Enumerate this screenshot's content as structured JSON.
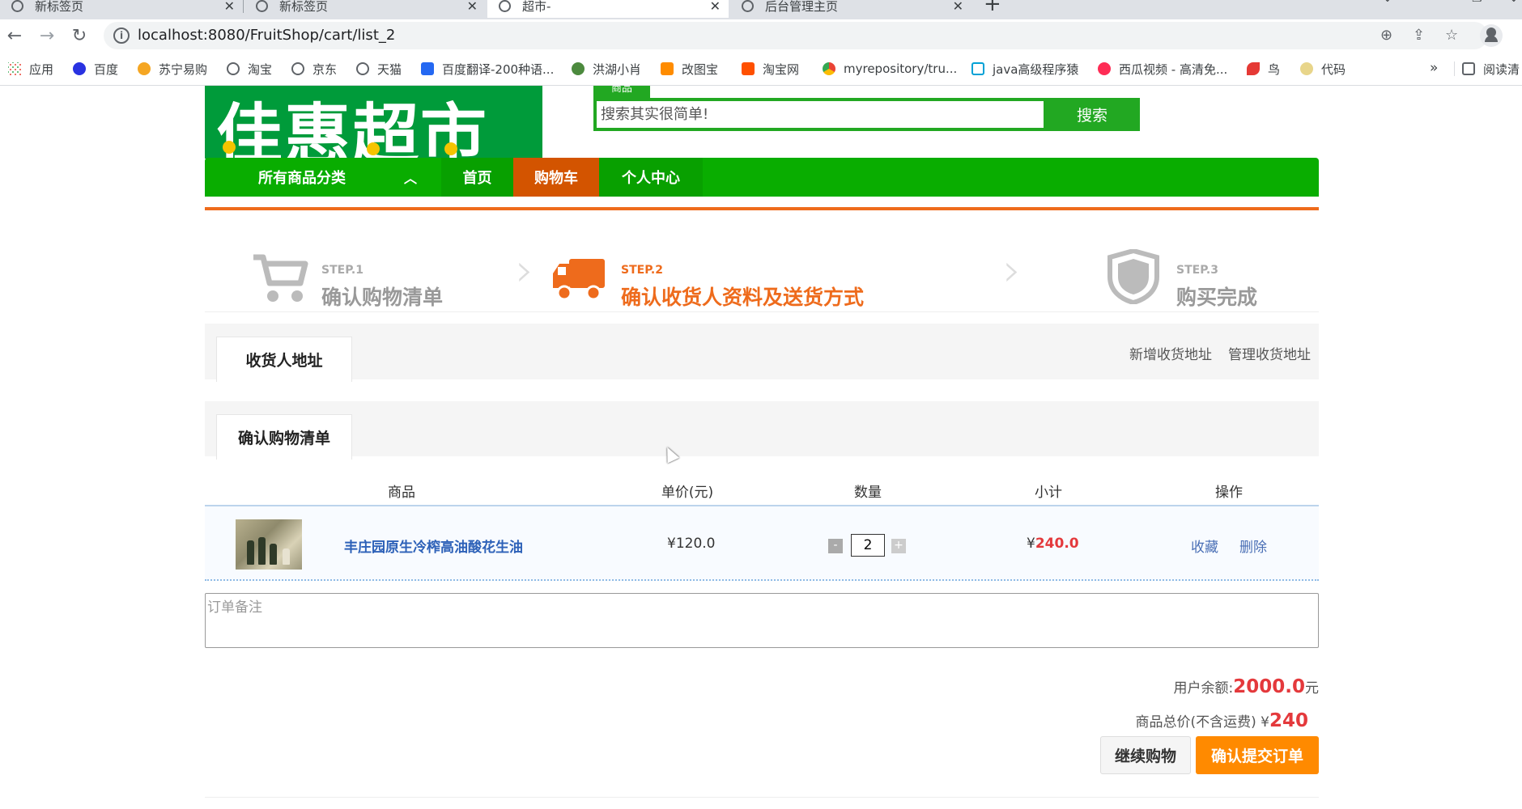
{
  "browser": {
    "tabs": [
      {
        "title": "新标签页",
        "active": false
      },
      {
        "title": "新标签页",
        "active": false
      },
      {
        "title": "超市-",
        "active": true
      },
      {
        "title": "后台管理主页",
        "active": false
      }
    ],
    "url": "localhost:8080/FruitShop/cart/list_2",
    "bookmarks": [
      {
        "label": "应用",
        "icon": "apps-icon",
        "color": "#ea4335"
      },
      {
        "label": "百度",
        "icon": "baidu-icon",
        "color": "#2932e1"
      },
      {
        "label": "苏宁易购",
        "icon": "suning-icon",
        "color": "#f5a623"
      },
      {
        "label": "淘宝",
        "icon": "globe-icon",
        "color": "#5f6368"
      },
      {
        "label": "京东",
        "icon": "globe-icon",
        "color": "#5f6368"
      },
      {
        "label": "天猫",
        "icon": "globe-icon",
        "color": "#5f6368"
      },
      {
        "label": "百度翻译-200种语...",
        "icon": "translate-icon",
        "color": "#2468f2"
      },
      {
        "label": "洪湖小肖",
        "icon": "bird-icon",
        "color": "#4c8a3e"
      },
      {
        "label": "改图宝",
        "icon": "gaitubao-icon",
        "color": "#ff8c00"
      },
      {
        "label": "淘宝网",
        "icon": "taobao-icon",
        "color": "#ff5000"
      },
      {
        "label": "myrepository/tru...",
        "icon": "chrome-icon",
        "color": "#34a853"
      },
      {
        "label": "java高级程序猿",
        "icon": "bilibili-icon",
        "color": "#00a1d6"
      },
      {
        "label": "西瓜视频 - 高清免...",
        "icon": "xigua-icon",
        "color": "#fe2c55"
      },
      {
        "label": "鸟",
        "icon": "bird-red-icon",
        "color": "#e53935"
      },
      {
        "label": "代码",
        "icon": "code-icon",
        "color": "#e8d58a"
      }
    ],
    "bookmarks_more": "»",
    "reading_list": "阅读清"
  },
  "header": {
    "logo_text": "佳惠超市",
    "search_tab": "商品",
    "search_placeholder": "搜索其实很简单!",
    "search_button": "搜索"
  },
  "nav": {
    "category": "所有商品分类",
    "items": [
      "首页",
      "购物车",
      "个人中心"
    ]
  },
  "steps": [
    {
      "label": "STEP.1",
      "title": "确认购物清单",
      "active": false
    },
    {
      "label": "STEP.2",
      "title": "确认收货人资料及送货方式",
      "active": true
    },
    {
      "label": "STEP.3",
      "title": "购买完成",
      "active": false
    }
  ],
  "address": {
    "tab": "收货人地址",
    "add_link": "新增收货地址",
    "manage_link": "管理收货地址"
  },
  "cart": {
    "tab": "确认购物清单",
    "columns": [
      "商品",
      "单价(元)",
      "数量",
      "小计",
      "操作"
    ],
    "rows": [
      {
        "name": "丰庄园原生冷榨高油酸花生油",
        "price": "¥120.0",
        "quantity": "2",
        "subtotal_symbol": "¥",
        "subtotal": "240.0",
        "actions": [
          "收藏",
          "删除"
        ]
      }
    ],
    "minus": "-",
    "plus": "+"
  },
  "remark_placeholder": "订单备注",
  "summary": {
    "balance_label": "用户余额:",
    "balance_value": "2000.0",
    "balance_unit": "元",
    "total_label": "商品总价(不含运费)",
    "total_symbol": "¥",
    "total_value": "240"
  },
  "buttons": {
    "continue": "继续购物",
    "submit": "确认提交订单"
  }
}
